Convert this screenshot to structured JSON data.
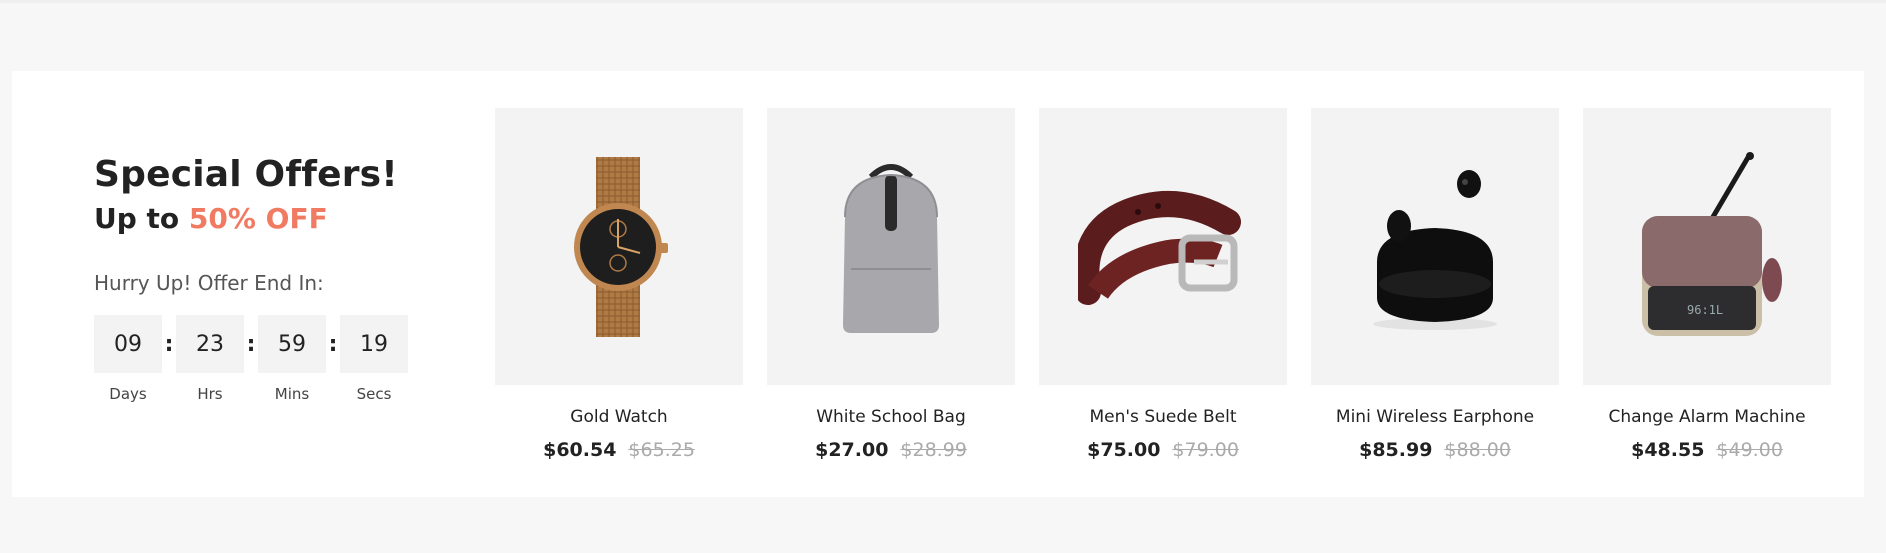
{
  "offer": {
    "title": "Special Offers!",
    "subtitle_prefix": "Up to",
    "subtitle_accent": "50% OFF",
    "hurry_text": "Hurry Up! Offer End In:",
    "accent_color": "#f07b62"
  },
  "timer": {
    "days": "09",
    "days_label": "Days",
    "hours": "23",
    "hours_label": "Hrs",
    "minutes": "59",
    "minutes_label": "Mins",
    "seconds": "19",
    "seconds_label": "Secs",
    "separator": ":"
  },
  "products": [
    {
      "name": "Gold Watch",
      "price": "$60.54",
      "old_price": "$65.25",
      "image": "watch-image"
    },
    {
      "name": "White School Bag",
      "price": "$27.00",
      "old_price": "$28.99",
      "image": "backpack-image"
    },
    {
      "name": "Men's Suede Belt",
      "price": "$75.00",
      "old_price": "$79.00",
      "image": "belt-image"
    },
    {
      "name": "Mini Wireless Earphone",
      "price": "$85.99",
      "old_price": "$88.00",
      "image": "earbuds-image"
    },
    {
      "name": "Change Alarm Machine",
      "price": "$48.55",
      "old_price": "$49.00",
      "image": "alarm-clock-image"
    }
  ]
}
